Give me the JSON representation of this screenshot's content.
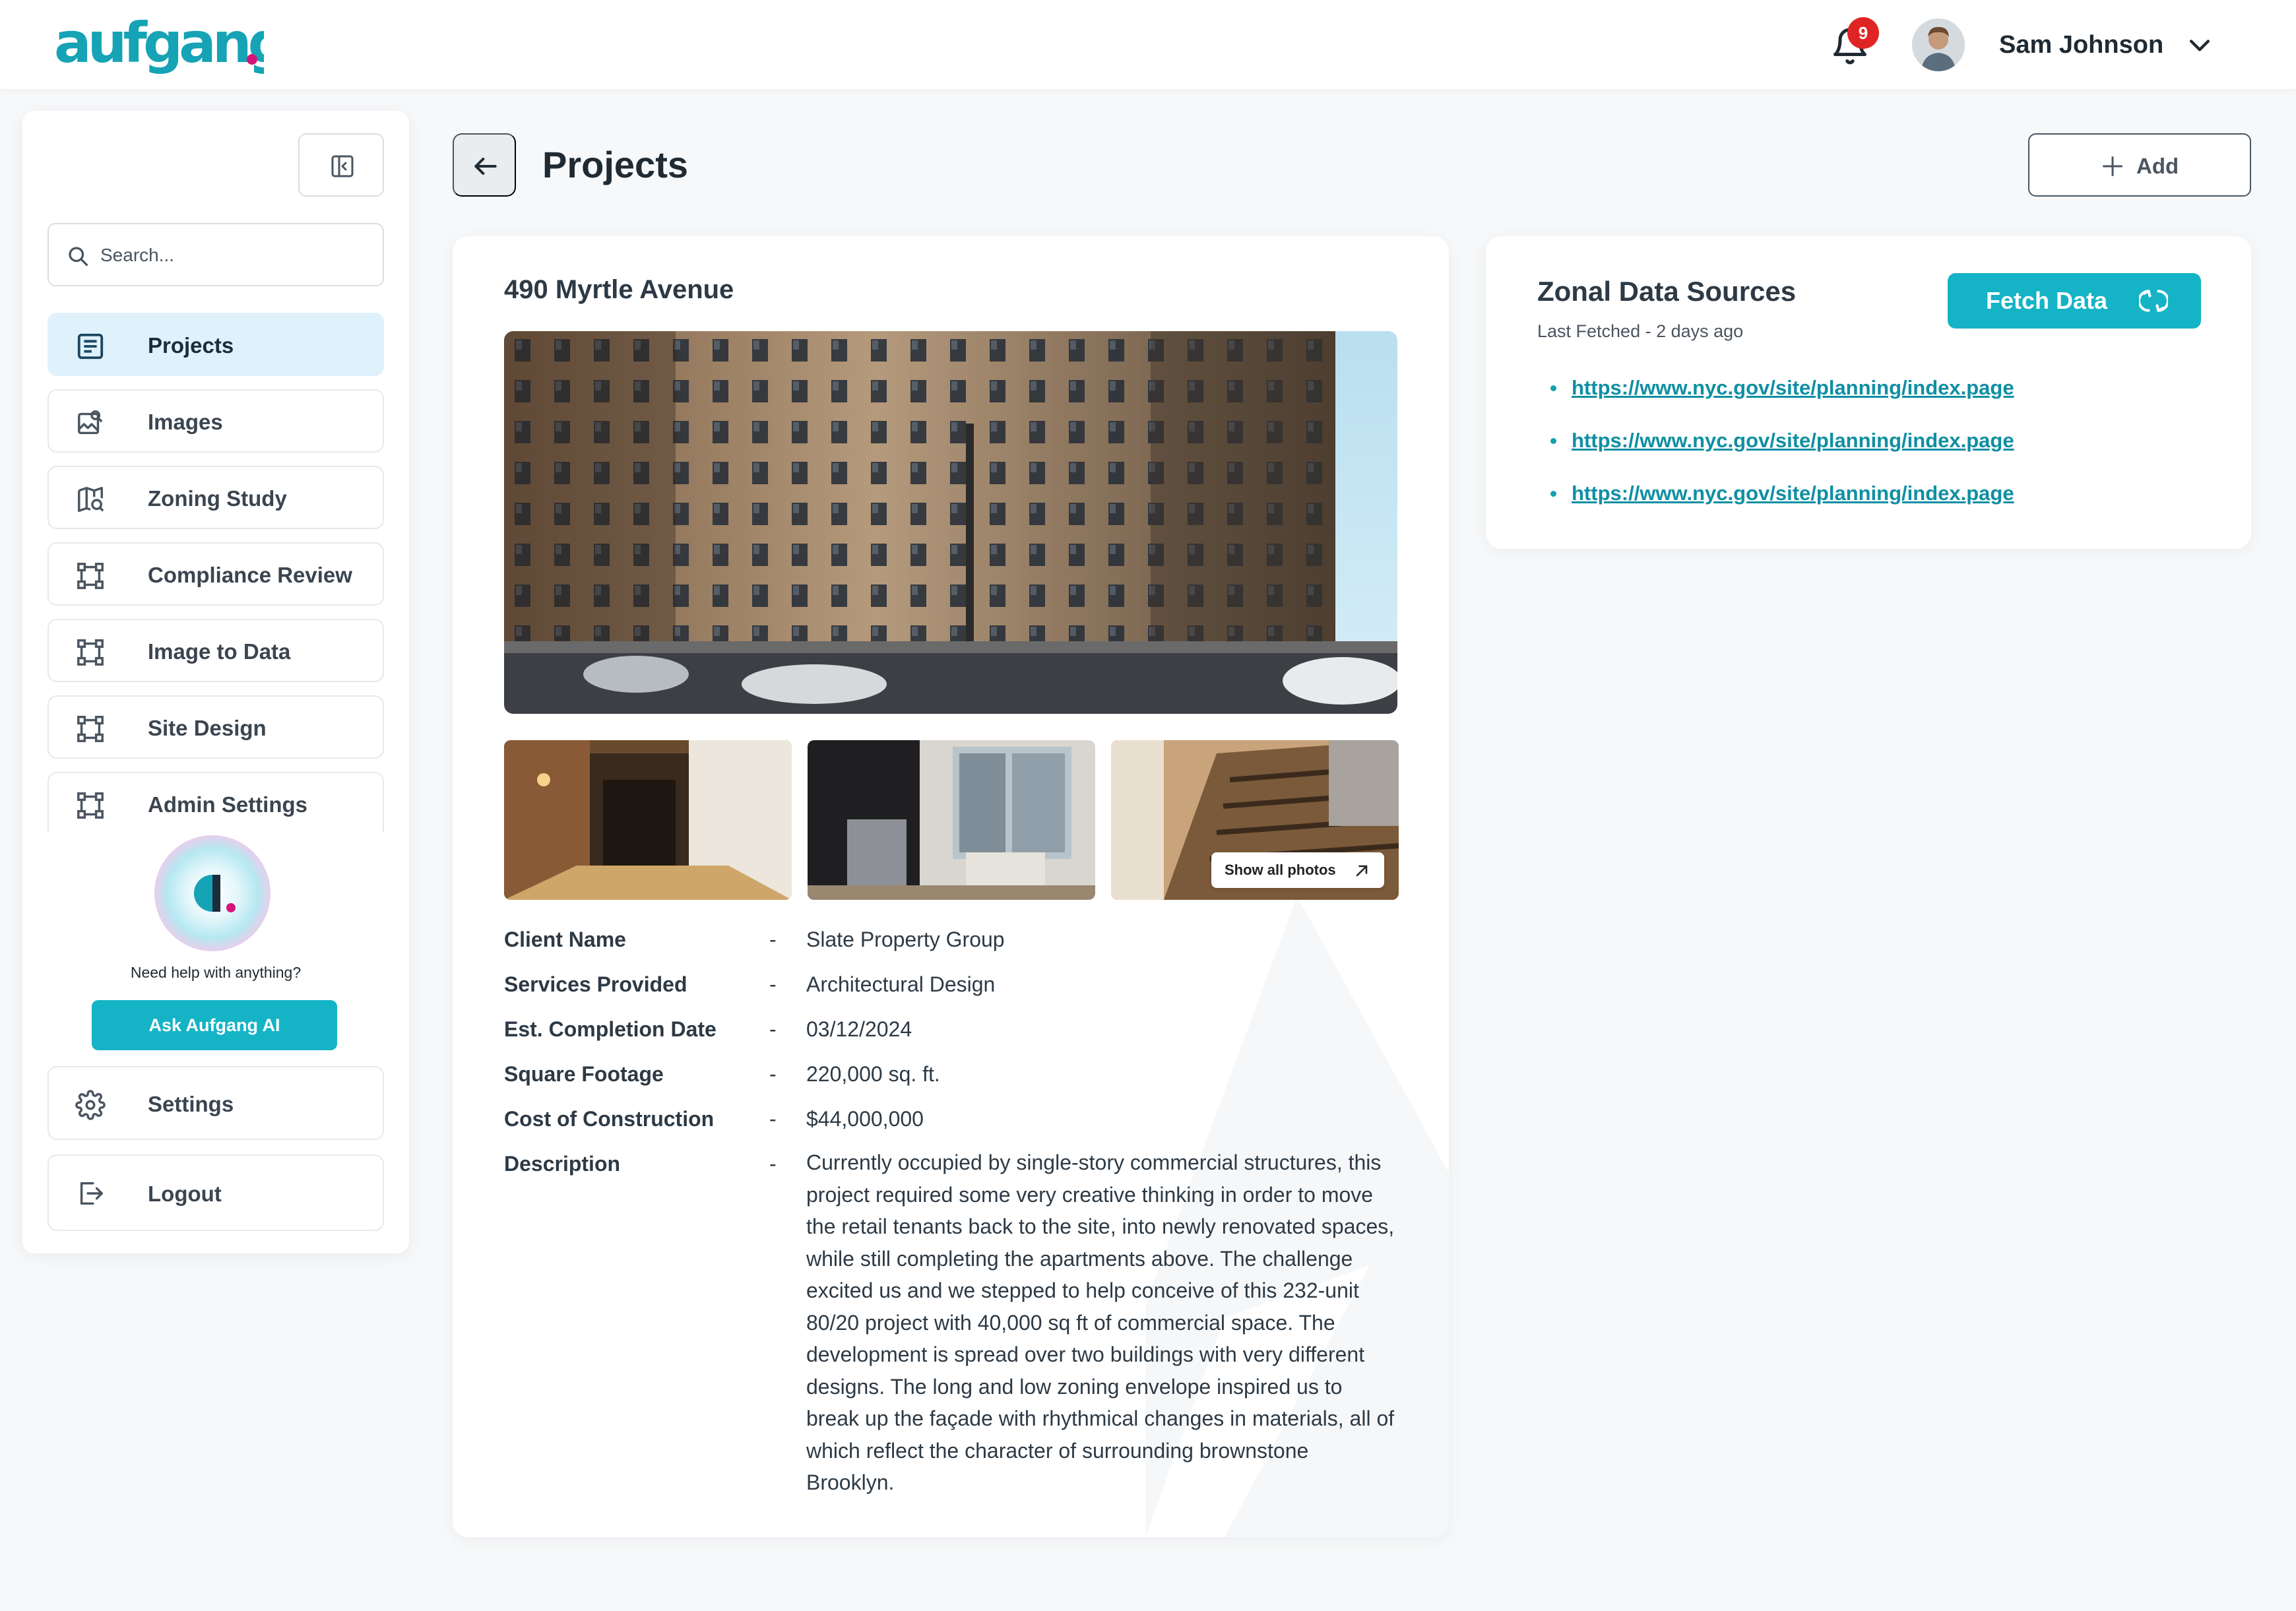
{
  "header": {
    "logo_text": "aufgang.",
    "notification_count": "9",
    "user_name": "Sam Johnson"
  },
  "sidebar": {
    "search_placeholder": "Search...",
    "items": [
      {
        "label": "Projects",
        "icon": "document-list-icon",
        "active": true
      },
      {
        "label": "Images",
        "icon": "image-icon",
        "active": false
      },
      {
        "label": "Zoning Study",
        "icon": "map-search-icon",
        "active": false
      },
      {
        "label": "Compliance Review",
        "icon": "frame-icon",
        "active": false
      },
      {
        "label": "Image to Data",
        "icon": "frame-icon",
        "active": false
      },
      {
        "label": "Site Design",
        "icon": "frame-icon",
        "active": false
      },
      {
        "label": "Admin Settings",
        "icon": "frame-icon",
        "active": false
      }
    ],
    "help_text": "Need help with anything?",
    "ask_button": "Ask Aufgang AI",
    "settings_label": "Settings",
    "logout_label": "Logout"
  },
  "page": {
    "title": "Projects",
    "add_label": "Add"
  },
  "project": {
    "name": "490 Myrtle Avenue",
    "show_photos": "Show all photos",
    "details": [
      {
        "label": "Client Name",
        "value": "Slate Property Group"
      },
      {
        "label": "Services Provided",
        "value": "Architectural Design"
      },
      {
        "label": "Est. Completion Date",
        "value": "03/12/2024"
      },
      {
        "label": "Square Footage",
        "value": "220,000 sq. ft."
      },
      {
        "label": "Cost of Construction",
        "value": "$44,000,000"
      },
      {
        "label": "Description",
        "value": "Currently occupied by single-story commercial structures, this project required some very creative thinking in order to move the retail tenants back to the site, into newly renovated spaces, while still completing the apartments above. The challenge excited us and we stepped to help conceive of this 232-unit 80/20 project with 40,000 sq ft of commercial space. The development is spread over two buildings with very different designs. The long and low zoning envelope inspired us to break up the façade with rhythmical changes in materials, all of which reflect the character of surrounding brownstone Brooklyn."
      }
    ],
    "separator": "-"
  },
  "zonal": {
    "title": "Zonal Data Sources",
    "last_fetched": "Last Fetched - 2 days ago",
    "fetch_label": "Fetch Data",
    "links": [
      "https://www.nyc.gov/site/planning/index.page",
      "https://www.nyc.gov/site/planning/index.page",
      "https://www.nyc.gov/site/planning/index.page"
    ]
  },
  "colors": {
    "accent": "#14b3c6",
    "active_nav_bg": "#dff1fb",
    "badge": "#e02424",
    "link": "#0f8fa3"
  }
}
